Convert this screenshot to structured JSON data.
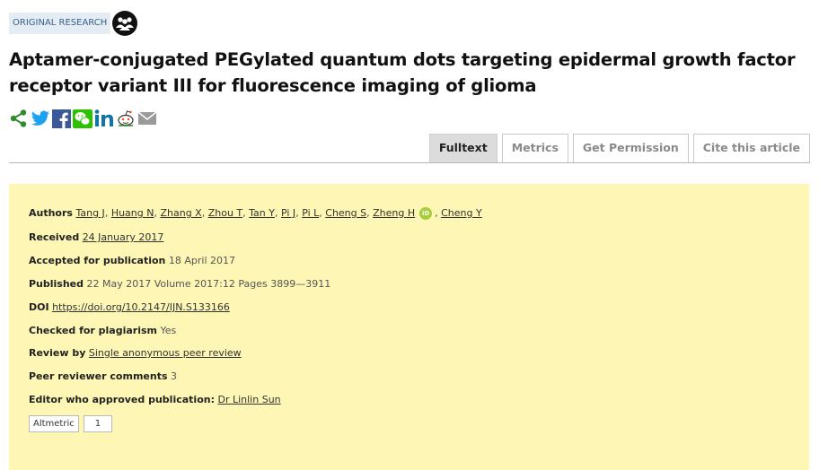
{
  "badge": {
    "label": "ORIGINAL RESEARCH",
    "icon": "peer-group-icon"
  },
  "title": "Aptamer-conjugated PEGylated quantum dots targeting epidermal growth factor receptor variant III for fluorescence imaging of glioma",
  "share_icons": [
    "share-icon",
    "twitter-icon",
    "facebook-icon",
    "wechat-icon",
    "linkedin-icon",
    "reddit-icon",
    "email-icon"
  ],
  "colors": {
    "share": "#2e8b2e",
    "twitter": "#1da1f2",
    "facebook": "#3b5998",
    "wechat": "#2dc100",
    "linkedin": "#0e76a8",
    "info_bg": "#fdf6b4"
  },
  "tabs": [
    {
      "label": "Fulltext",
      "active": true
    },
    {
      "label": "Metrics",
      "active": false
    },
    {
      "label": "Get Permission",
      "active": false
    },
    {
      "label": "Cite this article",
      "active": false
    }
  ],
  "info": {
    "authors_label": "Authors",
    "authors": [
      "Tang J",
      "Huang N",
      "Zhang X",
      "Zhou T",
      "Tan Y",
      "Pi J",
      "Pi L",
      "Cheng S",
      "Zheng H",
      "Cheng Y"
    ],
    "orcid_badge": "iD",
    "received_label": "Received",
    "received": "24 January 2017",
    "accepted_label": "Accepted for publication",
    "accepted": "18 April 2017",
    "published_label": "Published",
    "published": "22 May 2017 Volume 2017:12 Pages 3899—3911",
    "doi_label": "DOI",
    "doi": "https://doi.org/10.2147/IJN.S133166",
    "plagiarism_label": "Checked for plagiarism",
    "plagiarism": "Yes",
    "review_label": "Review by",
    "review": "Single anonymous peer review",
    "comments_label": "Peer reviewer comments",
    "comments": "3",
    "editor_label": "Editor who approved publication:",
    "editor": "Dr Linlin Sun",
    "altmetric_label": "Altmetric",
    "altmetric_count": "1"
  }
}
